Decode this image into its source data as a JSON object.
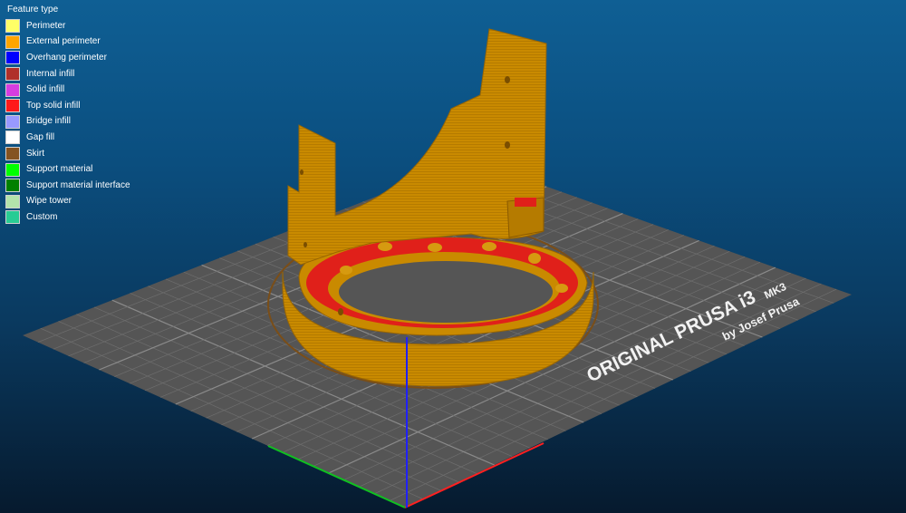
{
  "legend": {
    "title": "Feature type",
    "items": [
      {
        "label": "Perimeter",
        "color": "#ffff66"
      },
      {
        "label": "External perimeter",
        "color": "#ffa500"
      },
      {
        "label": "Overhang perimeter",
        "color": "#0000ff"
      },
      {
        "label": "Internal infill",
        "color": "#b03029"
      },
      {
        "label": "Solid infill",
        "color": "#d63de0"
      },
      {
        "label": "Top solid infill",
        "color": "#ff1a1a"
      },
      {
        "label": "Bridge infill",
        "color": "#9999ff"
      },
      {
        "label": "Gap fill",
        "color": "#ffffff"
      },
      {
        "label": "Skirt",
        "color": "#845321"
      },
      {
        "label": "Support material",
        "color": "#00ff00"
      },
      {
        "label": "Support material interface",
        "color": "#008000"
      },
      {
        "label": "Wipe tower",
        "color": "#b3e3ab"
      },
      {
        "label": "Custom",
        "color": "#28cc94"
      }
    ]
  },
  "bed": {
    "brand_line": "ORIGINAL PRUSA i3",
    "model": "MK3",
    "maker_line": "by Josef Prusa",
    "surface_color": "#555555",
    "grid_color": "#6e6e6e"
  },
  "model": {
    "color": "#c98a00",
    "shade_color": "#a86f00",
    "infill_color": "#e0201a"
  },
  "axes": {
    "x_color": "#ff2020",
    "y_color": "#10c020",
    "z_color": "#2020ff"
  }
}
